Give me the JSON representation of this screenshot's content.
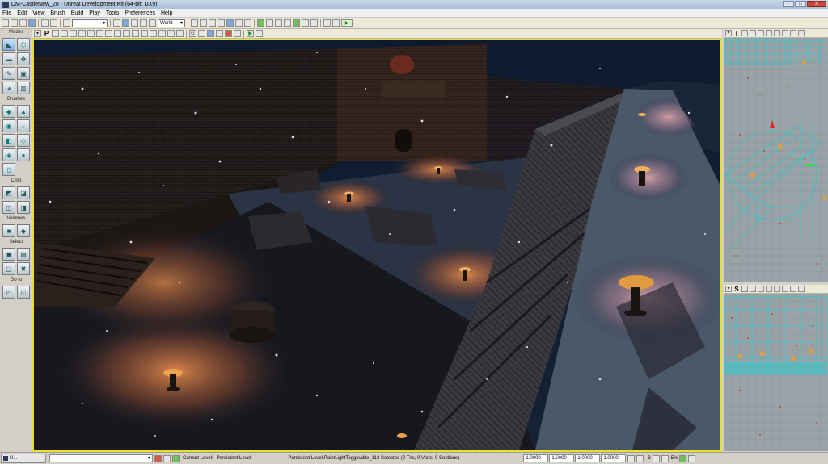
{
  "window": {
    "title": "DM-CastleNew_28 - Unreal Development Kit (64-bit, DX9)",
    "minimize": "-",
    "maximize": "□",
    "close": "X"
  },
  "menu": [
    "File",
    "Edit",
    "View",
    "Brush",
    "Build",
    "Play",
    "Tools",
    "Preferences",
    "Help"
  ],
  "toolbar": {
    "search_value": "",
    "coord_system": "World",
    "combo_arrow": "▾",
    "play_icon": "▶",
    "grid_letter": "G"
  },
  "modes_panel": {
    "title": "Modes",
    "brushes_title": "Brushes",
    "csg_title": "CSG",
    "volumes_title": "Volumes",
    "select_title": "Select",
    "goto_title": "Go to"
  },
  "viewport_toolbar": {
    "perspective_letter": "P",
    "play_icon": "▶"
  },
  "side_viewports": {
    "top_letter": "T",
    "side_letter": "S",
    "arrow": "▾"
  },
  "statusbar": {
    "task_button": "U...",
    "current_level_label": "Current Level:",
    "current_level_value": "Persistent Level",
    "selection_text": "Persistent Level.PointLightToggleable_113 Selected (0 Tris, 0 Verts, 0 Sections)",
    "drag_x": "1.0000",
    "drag_y": "1.0000",
    "drag_z": "1.0000",
    "drag_w": "1.0000",
    "grid_value": "-3",
    "zoom_value": "5%"
  },
  "colors": {
    "viewport_border": "#e8e02a",
    "light_glow": "#d9804a",
    "wireframe": "#2ec8c8"
  }
}
